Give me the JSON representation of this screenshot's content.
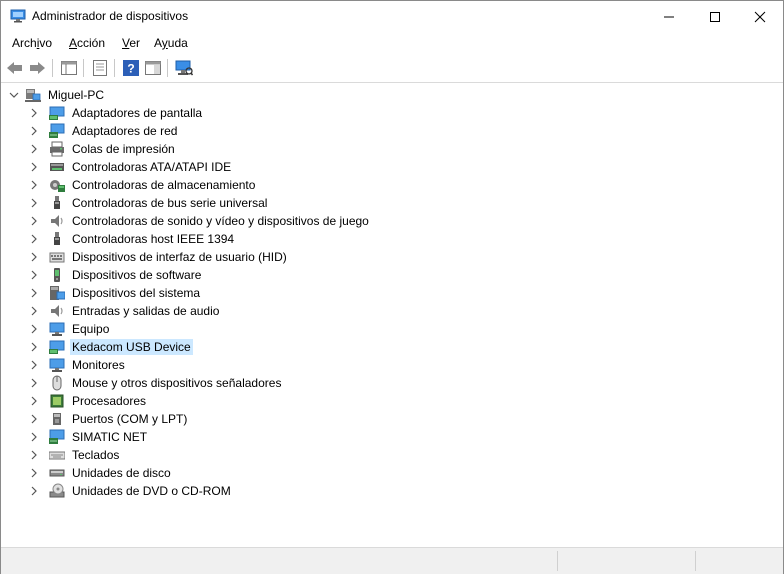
{
  "window": {
    "title": "Administrador de dispositivos"
  },
  "menu": [
    {
      "label": "Archivo",
      "pre": "Arch",
      "u": "i",
      "post": "vo"
    },
    {
      "label": "Acción",
      "pre": "",
      "u": "A",
      "post": "cción"
    },
    {
      "label": "Ver",
      "pre": "",
      "u": "V",
      "post": "er"
    },
    {
      "label": "Ayuda",
      "pre": "A",
      "u": "y",
      "post": "uda"
    }
  ],
  "tree": {
    "root": "Miguel-PC",
    "items": [
      {
        "label": "Adaptadores de pantalla",
        "icon": "display-adapter-icon"
      },
      {
        "label": "Adaptadores de red",
        "icon": "network-adapter-icon"
      },
      {
        "label": "Colas de impresión",
        "icon": "printer-icon"
      },
      {
        "label": "Controladoras ATA/ATAPI IDE",
        "icon": "ide-controller-icon"
      },
      {
        "label": "Controladoras de almacenamiento",
        "icon": "storage-controller-icon"
      },
      {
        "label": "Controladoras de bus serie universal",
        "icon": "usb-icon"
      },
      {
        "label": "Controladoras de sonido y vídeo y dispositivos de juego",
        "icon": "speaker-icon"
      },
      {
        "label": "Controladoras host IEEE 1394",
        "icon": "ieee1394-icon"
      },
      {
        "label": "Dispositivos de interfaz de usuario (HID)",
        "icon": "hid-icon"
      },
      {
        "label": "Dispositivos de software",
        "icon": "software-device-icon"
      },
      {
        "label": "Dispositivos del sistema",
        "icon": "system-device-icon"
      },
      {
        "label": "Entradas y salidas de audio",
        "icon": "audio-io-icon"
      },
      {
        "label": "Equipo",
        "icon": "computer-icon"
      },
      {
        "label": "Kedacom USB Device",
        "icon": "usb-device-icon",
        "selected": true
      },
      {
        "label": "Monitores",
        "icon": "monitor-icon"
      },
      {
        "label": "Mouse y otros dispositivos señaladores",
        "icon": "mouse-icon"
      },
      {
        "label": "Procesadores",
        "icon": "processor-icon"
      },
      {
        "label": "Puertos (COM y LPT)",
        "icon": "port-icon"
      },
      {
        "label": "SIMATIC NET",
        "icon": "simatic-icon"
      },
      {
        "label": "Teclados",
        "icon": "keyboard-icon"
      },
      {
        "label": "Unidades de disco",
        "icon": "disk-drive-icon"
      },
      {
        "label": "Unidades de DVD o CD-ROM",
        "icon": "dvd-drive-icon"
      }
    ]
  },
  "colors": {
    "selection": "#cce8ff",
    "accent": "#2c7fd6"
  }
}
